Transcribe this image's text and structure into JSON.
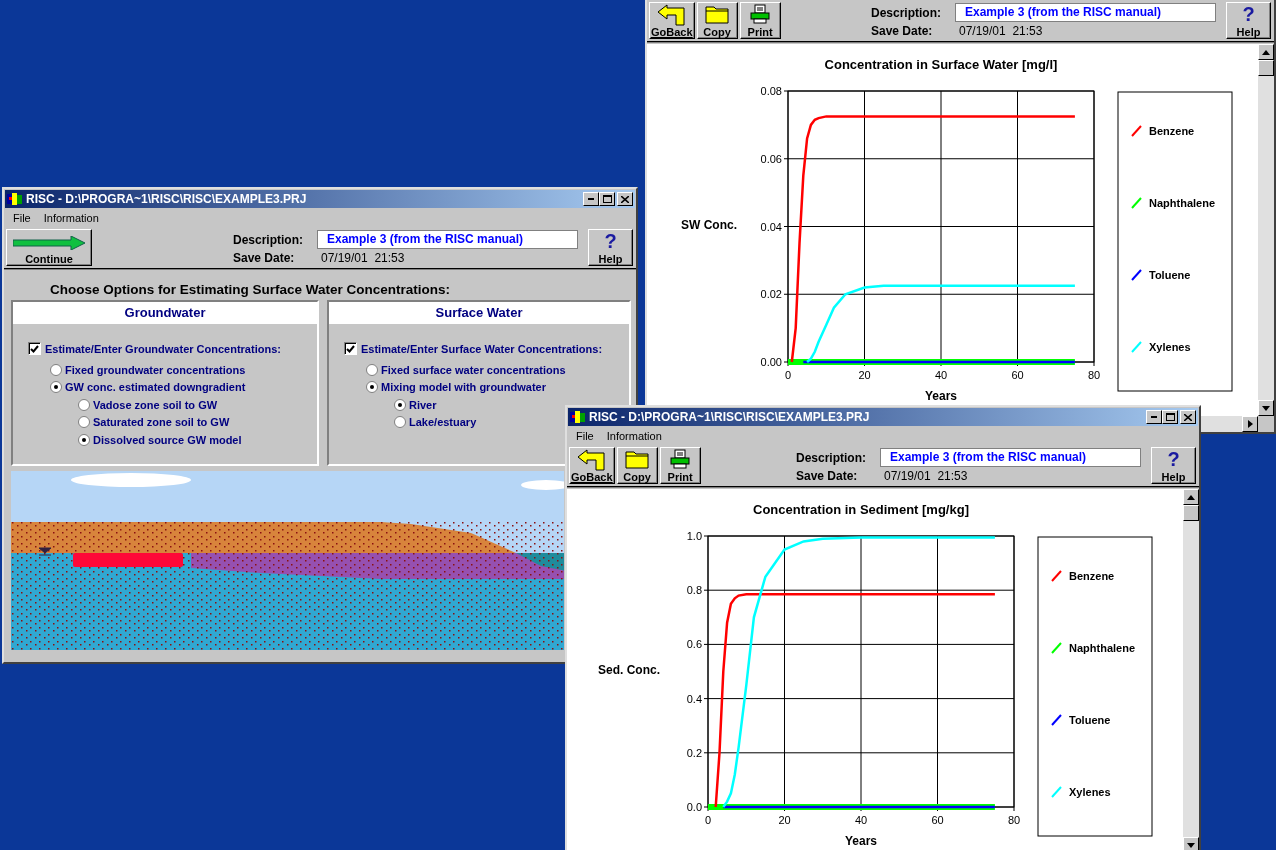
{
  "windows": [
    {
      "kind": "options",
      "title": "RISC - D:\\PROGRA~1\\RISC\\RISC\\EXAMPLE3.PRJ",
      "menu": [
        "File",
        "Information"
      ],
      "toolbar": {
        "buttons": [
          {
            "kind": "continue",
            "label": "Continue"
          }
        ],
        "description_label": "Description:",
        "description": "Example 3 (from the RISC manual)",
        "save_date_label": "Save Date:",
        "save_date": "07/19/01  21:53",
        "help": {
          "glyph": "?",
          "label": "Help"
        }
      },
      "heading": "Choose Options for Estimating Surface Water Concentrations:",
      "panels": [
        {
          "title": "Groundwater",
          "checkbox": {
            "label": "Estimate/Enter Groundwater Concentrations:",
            "checked": true
          },
          "options": [
            {
              "label": "Fixed groundwater concentrations",
              "selected": false
            },
            {
              "label": "GW conc. estimated downgradient",
              "selected": true,
              "children": [
                {
                  "label": "Vadose zone soil to GW",
                  "selected": false
                },
                {
                  "label": "Saturated zone soil to GW",
                  "selected": false
                },
                {
                  "label": "Dissolved source GW model",
                  "selected": true
                }
              ]
            }
          ]
        },
        {
          "title": "Surface Water",
          "checkbox": {
            "label": "Estimate/Enter Surface Water Concentrations:",
            "checked": true
          },
          "options": [
            {
              "label": "Fixed surface water concentrations",
              "selected": false
            },
            {
              "label": "Mixing model with groundwater",
              "selected": true,
              "children": [
                {
                  "label": "River",
                  "selected": true
                },
                {
                  "label": "Lake/estuary",
                  "selected": false
                }
              ]
            }
          ]
        }
      ]
    },
    {
      "kind": "chart",
      "toolbar": {
        "buttons": [
          {
            "kind": "goback",
            "label": "GoBack"
          },
          {
            "kind": "copy",
            "label": "Copy"
          },
          {
            "kind": "print",
            "label": "Print"
          }
        ],
        "description_label": "Description:",
        "description": "Example 3 (from the RISC manual)",
        "save_date_label": "Save Date:",
        "save_date": "07/19/01  21:53",
        "help": {
          "glyph": "?",
          "label": "Help"
        }
      },
      "chart_data": {
        "type": "line",
        "title": "Concentration in Surface Water [mg/l]",
        "xlabel": "Years",
        "ylabel": "SW Conc.",
        "grid": true,
        "legend": true,
        "x": [
          0,
          1,
          2,
          3,
          4,
          5,
          6,
          7,
          8,
          10,
          12,
          15,
          20,
          25,
          30,
          40,
          50,
          60,
          75
        ],
        "xlim": [
          0,
          80
        ],
        "ylim": [
          0,
          0.08
        ],
        "xticks": [
          0,
          20,
          40,
          60,
          80
        ],
        "yticks": [
          {
            "value": 0,
            "label": "0.00"
          },
          {
            "value": 0.02,
            "label": "0.02"
          },
          {
            "value": 0.04,
            "label": "0.04"
          },
          {
            "value": 0.06,
            "label": "0.06"
          },
          {
            "value": 0.08,
            "label": "0.08"
          }
        ],
        "series": [
          {
            "name": "Benzene",
            "color": "#ff0000",
            "values": [
              null,
              0,
              0.01,
              0.035,
              0.055,
              0.066,
              0.07,
              0.0715,
              0.072,
              0.0725,
              0.0725,
              0.0725,
              0.0725,
              0.0725,
              0.0725,
              0.0725,
              0.0725,
              0.0725,
              0.0725
            ]
          },
          {
            "name": "Naphthalene",
            "color": "#00ff00",
            "values": [
              0,
              0,
              0,
              0,
              0,
              0,
              0,
              0,
              0,
              0,
              0,
              0,
              0,
              0,
              0,
              0,
              0,
              0,
              0
            ]
          },
          {
            "name": "Toluene",
            "color": "#0000ff",
            "values": [
              null,
              null,
              null,
              null,
              0,
              0,
              0,
              0,
              0,
              0,
              0,
              0,
              0,
              0,
              0,
              0,
              0,
              0,
              0
            ]
          },
          {
            "name": "Xylenes",
            "color": "#00ffff",
            "values": [
              null,
              null,
              null,
              null,
              null,
              0,
              0.001,
              0.003,
              0.006,
              0.011,
              0.016,
              0.02,
              0.022,
              0.0225,
              0.0225,
              0.0225,
              0.0225,
              0.0225,
              0.0225
            ]
          }
        ]
      }
    },
    {
      "kind": "chart",
      "title": "RISC - D:\\PROGRA~1\\RISC\\RISC\\EXAMPLE3.PRJ",
      "menu": [
        "File",
        "Information"
      ],
      "toolbar": {
        "buttons": [
          {
            "kind": "goback",
            "label": "GoBack"
          },
          {
            "kind": "copy",
            "label": "Copy"
          },
          {
            "kind": "print",
            "label": "Print"
          }
        ],
        "description_label": "Description:",
        "description": "Example 3 (from the RISC manual)",
        "save_date_label": "Save Date:",
        "save_date": "07/19/01  21:53",
        "help": {
          "glyph": "?",
          "label": "Help"
        }
      },
      "chart_data": {
        "type": "line",
        "title": "Concentration in Sediment [mg/kg]",
        "xlabel": "Years",
        "ylabel": "Sed. Conc.",
        "grid": true,
        "legend": true,
        "x": [
          0,
          1,
          2,
          3,
          4,
          5,
          6,
          7,
          8,
          10,
          12,
          15,
          20,
          25,
          30,
          40,
          50,
          60,
          75
        ],
        "xlim": [
          0,
          80
        ],
        "ylim": [
          0,
          1
        ],
        "xticks": [
          0,
          20,
          40,
          60,
          80
        ],
        "yticks": [
          {
            "value": 0,
            "label": "0.0"
          },
          {
            "value": 0.2,
            "label": "0.2"
          },
          {
            "value": 0.4,
            "label": "0.4"
          },
          {
            "value": 0.6,
            "label": "0.6"
          },
          {
            "value": 0.8,
            "label": "0.8"
          },
          {
            "value": 1,
            "label": "1.0"
          }
        ],
        "series": [
          {
            "name": "Benzene",
            "color": "#ff0000",
            "values": [
              null,
              null,
              0,
              0.2,
              0.5,
              0.68,
              0.75,
              0.77,
              0.78,
              0.785,
              0.785,
              0.785,
              0.785,
              0.785,
              0.785,
              0.785,
              0.785,
              0.785,
              0.785
            ]
          },
          {
            "name": "Naphthalene",
            "color": "#00ff00",
            "values": [
              0,
              0,
              0,
              0,
              0,
              0,
              0,
              0,
              0,
              0,
              0,
              0,
              0,
              0,
              0,
              0,
              0,
              0,
              0
            ]
          },
          {
            "name": "Toluene",
            "color": "#0000ff",
            "values": [
              null,
              null,
              null,
              null,
              0,
              0,
              0,
              0,
              0,
              0,
              0,
              0,
              0,
              0,
              0,
              0,
              0,
              0,
              0
            ]
          },
          {
            "name": "Xylenes",
            "color": "#00ffff",
            "values": [
              null,
              null,
              null,
              null,
              0,
              0.02,
              0.05,
              0.12,
              0.22,
              0.45,
              0.7,
              0.85,
              0.95,
              0.98,
              0.99,
              0.995,
              0.995,
              0.995,
              0.995
            ]
          }
        ]
      }
    }
  ]
}
